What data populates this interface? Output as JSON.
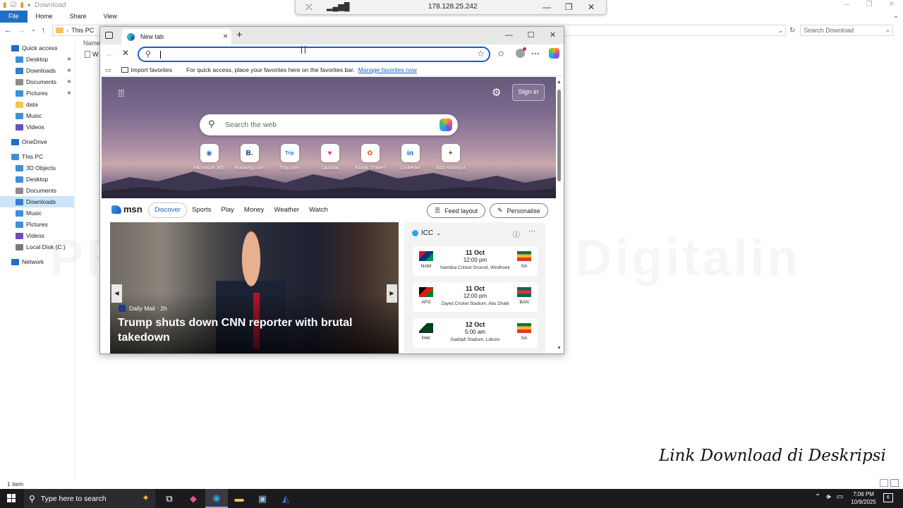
{
  "explorer": {
    "title": "Download",
    "ribbon_tabs": [
      "File",
      "Home",
      "Share",
      "View"
    ],
    "breadcrumb": "This PC",
    "search_placeholder": "Search Download",
    "column_header": "Name",
    "file_item_partial": "W",
    "status": "1 item",
    "nav": [
      {
        "label": "Quick access",
        "icon": "star-icon",
        "color": "#1f6fc4",
        "pinned": false,
        "selected": false,
        "indent": 1
      },
      {
        "label": "Desktop",
        "icon": "desktop-icon",
        "color": "#3d8fd8",
        "pinned": true,
        "selected": false,
        "indent": 2
      },
      {
        "label": "Downloads",
        "icon": "download-arrow-icon",
        "color": "#2f7fd0",
        "pinned": true,
        "selected": false,
        "indent": 2
      },
      {
        "label": "Documents",
        "icon": "documents-icon",
        "color": "#8c8c8c",
        "pinned": true,
        "selected": false,
        "indent": 2
      },
      {
        "label": "Pictures",
        "icon": "pictures-icon",
        "color": "#3d8fd8",
        "pinned": true,
        "selected": false,
        "indent": 2
      },
      {
        "label": "data",
        "icon": "folder-icon",
        "color": "#f3c553",
        "pinned": false,
        "selected": false,
        "indent": 2
      },
      {
        "label": "Music",
        "icon": "music-icon",
        "color": "#3d8fd8",
        "pinned": false,
        "selected": false,
        "indent": 2
      },
      {
        "label": "Videos",
        "icon": "videos-icon",
        "color": "#6b4fbb",
        "pinned": false,
        "selected": false,
        "indent": 2
      },
      {
        "label": "OneDrive",
        "icon": "cloud-icon",
        "color": "#1f6fc4",
        "pinned": false,
        "selected": false,
        "indent": 1,
        "gap": true
      },
      {
        "label": "This PC",
        "icon": "computer-icon",
        "color": "#3d8fd8",
        "pinned": false,
        "selected": false,
        "indent": 1,
        "gap": true
      },
      {
        "label": "3D Objects",
        "icon": "cube-icon",
        "color": "#3d8fd8",
        "pinned": false,
        "selected": false,
        "indent": 2
      },
      {
        "label": "Desktop",
        "icon": "desktop-icon",
        "color": "#3d8fd8",
        "pinned": false,
        "selected": false,
        "indent": 2
      },
      {
        "label": "Documents",
        "icon": "documents-icon",
        "color": "#8c8c8c",
        "pinned": false,
        "selected": false,
        "indent": 2
      },
      {
        "label": "Downloads",
        "icon": "download-arrow-icon",
        "color": "#2f7fd0",
        "pinned": false,
        "selected": true,
        "indent": 2
      },
      {
        "label": "Music",
        "icon": "music-icon",
        "color": "#3d8fd8",
        "pinned": false,
        "selected": false,
        "indent": 2
      },
      {
        "label": "Pictures",
        "icon": "pictures-icon",
        "color": "#3d8fd8",
        "pinned": false,
        "selected": false,
        "indent": 2
      },
      {
        "label": "Videos",
        "icon": "videos-icon",
        "color": "#6b4fbb",
        "pinned": false,
        "selected": false,
        "indent": 2
      },
      {
        "label": "Local Disk (C:)",
        "icon": "drive-icon",
        "color": "#7a7a7a",
        "pinned": false,
        "selected": false,
        "indent": 2
      },
      {
        "label": "Network",
        "icon": "network-icon",
        "color": "#1f6fc4",
        "pinned": false,
        "selected": false,
        "indent": 1,
        "gap": true
      }
    ]
  },
  "remote": {
    "ip": "178.128.25.242"
  },
  "watermark": "PRODUCT BY Toko Digitalin",
  "caption": "Link Download di Deskripsi",
  "browser": {
    "tab_title": "New tab",
    "address_value": "",
    "favbar": {
      "import": "Import favorites",
      "hint": "For quick access, place your favorites here on the favorites bar.",
      "manage": "Manage favorites now"
    },
    "page": {
      "sign_in": "Sign in",
      "search_placeholder": "Search the web",
      "shortcuts": [
        {
          "label": "Microsoft 365",
          "glyph": "◉",
          "color": "#3b6fd8"
        },
        {
          "label": "Booking.com",
          "glyph": "B.",
          "color": "#0b3a82"
        },
        {
          "label": "Trip.com",
          "glyph": "Trip",
          "color": "#2a7de1"
        },
        {
          "label": "Lazada",
          "glyph": "♥",
          "color": "#f23a6a"
        },
        {
          "label": "Klook Travel",
          "glyph": "✿",
          "color": "#ff5b00"
        },
        {
          "label": "Linkedin",
          "glyph": "in",
          "color": "#0a66c2"
        },
        {
          "label": "Add shortcut",
          "glyph": "+",
          "color": "#444444"
        }
      ],
      "brand": "msn",
      "nav": [
        "Discover",
        "Sports",
        "Play",
        "Money",
        "Weather",
        "Watch"
      ],
      "feed_layout": "Feed layout",
      "personalise": "Personalise",
      "hero_card": {
        "source": "Daily Mail · 2h",
        "headline": "Trump shuts down CNN reporter with brutal takedown"
      },
      "icc": {
        "title": "ICC",
        "matches": [
          {
            "team1": "NAM",
            "team2": "SA",
            "date": "11 Oct",
            "time": "12:00 pm",
            "venue": "Namibia Cricket Ground, Windhoek",
            "flag1": [
              "#d21034",
              "#003580",
              "#009543"
            ],
            "flag2": [
              "#007749",
              "#ffb81c",
              "#de3831"
            ]
          },
          {
            "team1": "AFG",
            "team2": "BAN",
            "date": "11 Oct",
            "time": "12:00 pm",
            "venue": "Zayed Cricket Stadium, Abu Dhabi",
            "flag1": [
              "#000000",
              "#d32011",
              "#007a36"
            ],
            "flag2": [
              "#006a4e",
              "#f42a41",
              "#006a4e"
            ]
          },
          {
            "team1": "PAK",
            "team2": "SA",
            "date": "12 Oct",
            "time": "5:00 am",
            "venue": "Gaddafi Stadium, Lahore",
            "flag1": [
              "#ffffff",
              "#01411c",
              "#01411c"
            ],
            "flag2": [
              "#007749",
              "#ffb81c",
              "#de3831"
            ]
          }
        ]
      }
    }
  },
  "taskbar": {
    "search_placeholder": "Type here to search",
    "time": "7:06 PM",
    "date": "10/9/2025",
    "notifications": "6"
  }
}
